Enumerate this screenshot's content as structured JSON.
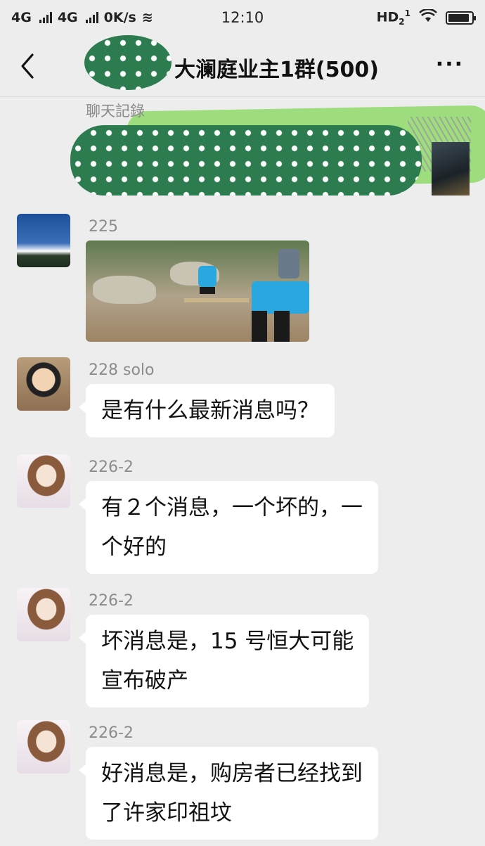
{
  "status_bar": {
    "net1": "4G",
    "net2": "4G",
    "speed": "0K/s",
    "time": "12:10",
    "hd": "HD",
    "battery_level": 0.9
  },
  "header": {
    "title": "大澜庭业主1群(500)",
    "back_icon": "chevron-left-icon",
    "more_label": "···"
  },
  "record": {
    "label": "聊天記錄"
  },
  "messages": [
    {
      "sender": "225",
      "type": "image",
      "avatar": "sky-avatar"
    },
    {
      "sender": "228 solo",
      "type": "text",
      "lines": [
        "是有什么最新消息吗？"
      ],
      "avatar": "kid-avatar"
    },
    {
      "sender": "226-2",
      "type": "text",
      "lines": [
        "有２个消息，一个坏的，一",
        "个好的"
      ],
      "avatar": "girl-avatar"
    },
    {
      "sender": "226-2",
      "type": "text",
      "lines": [
        "坏消息是，15 号恒大可能",
        "宣布破产"
      ],
      "avatar": "girl-avatar"
    },
    {
      "sender": "226-2",
      "type": "text",
      "lines": [
        "好消息是，购房者已经找到",
        "了许家印祖坟"
      ],
      "avatar": "girl-avatar"
    }
  ],
  "colors": {
    "background": "#ededed",
    "bubble": "#ffffff",
    "censor_green": "#2d7c4f"
  }
}
